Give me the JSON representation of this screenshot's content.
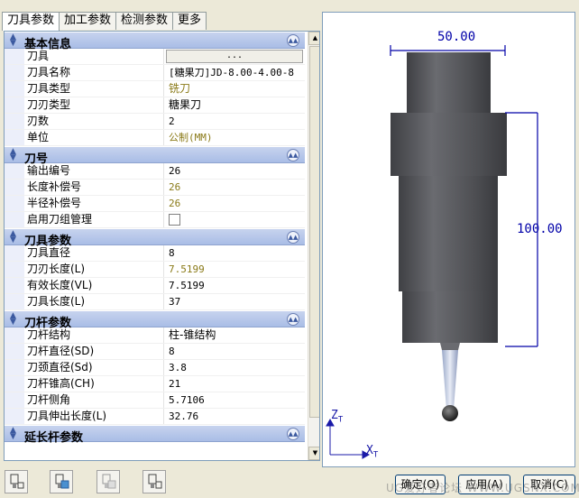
{
  "tabs": [
    "刀具参数",
    "加工参数",
    "检测参数",
    "更多"
  ],
  "groups": {
    "basic": {
      "title": "基本信息",
      "rows": [
        {
          "key": "刀具",
          "value": "..."
        },
        {
          "key": "刀具名称",
          "value": "[糖果刀]JD-8.00-4.00-8"
        },
        {
          "key": "刀具类型",
          "value": "铣刀"
        },
        {
          "key": "刀刃类型",
          "value": "糖果刀"
        },
        {
          "key": "刃数",
          "value": "2"
        },
        {
          "key": "单位",
          "value": "公制(MM)"
        }
      ]
    },
    "number": {
      "title": "刀号",
      "rows": [
        {
          "key": "输出编号",
          "value": "26"
        },
        {
          "key": "长度补偿号",
          "value": "26"
        },
        {
          "key": "半径补偿号",
          "value": "26"
        },
        {
          "key": "启用刀组管理",
          "value": ""
        }
      ]
    },
    "tool": {
      "title": "刀具参数",
      "rows": [
        {
          "key": "刀具直径",
          "value": "8"
        },
        {
          "key": "刀刃长度(L)",
          "value": "7.5199"
        },
        {
          "key": "有效长度(VL)",
          "value": "7.5199"
        },
        {
          "key": "刀具长度(L)",
          "value": "37"
        }
      ]
    },
    "shank": {
      "title": "刀杆参数",
      "rows": [
        {
          "key": "刀杆结构",
          "value": "柱-锥结构"
        },
        {
          "key": "刀杆直径(SD)",
          "value": "8"
        },
        {
          "key": "刀颈直径(Sd)",
          "value": "3.8"
        },
        {
          "key": "刀杆锥高(CH)",
          "value": "21"
        },
        {
          "key": "刀杆侧角",
          "value": "5.7106"
        },
        {
          "key": "刀具伸出长度(L)",
          "value": "32.76"
        }
      ]
    },
    "extension": {
      "title": "延长杆参数"
    }
  },
  "preview": {
    "width_dim": "50.00",
    "length_dim": "100.00",
    "axis_z": "Z",
    "axis_x": "X",
    "axis_sub": "T"
  },
  "buttons": {
    "ok": "确定(O)",
    "apply": "应用(A)",
    "cancel": "取消(C)"
  },
  "watermark": "UG爱好者论坛 WWW.UGSNX.COM",
  "colors": {
    "group_header": "#b8c8ec",
    "highlight_value": "#8a7a18",
    "dimension": "#0000a8",
    "axis": "#1a1aa8"
  }
}
